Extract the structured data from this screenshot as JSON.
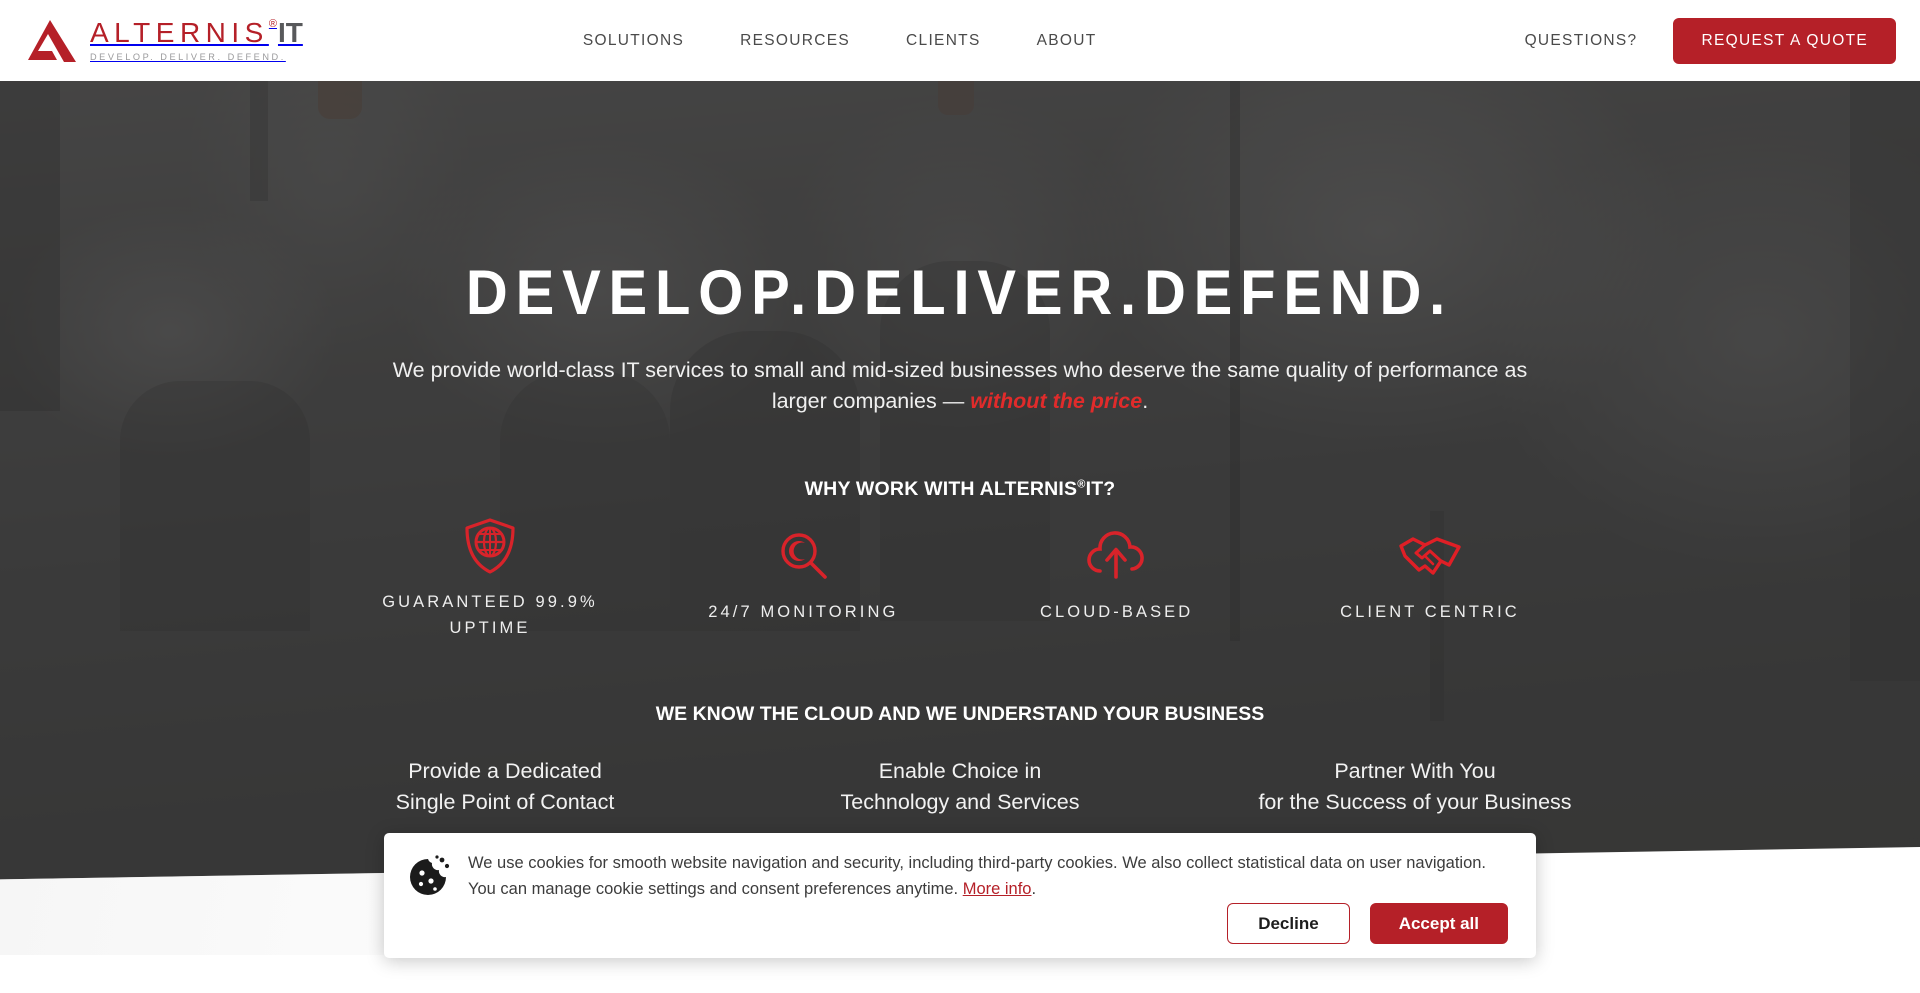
{
  "header": {
    "logo": {
      "name_main": "ALTERNIS",
      "registered_mark": "®",
      "name_suffix": "IT",
      "tagline": "DEVELOP. DELIVER. DEFEND."
    },
    "nav_items": [
      {
        "label": "SOLUTIONS"
      },
      {
        "label": "RESOURCES"
      },
      {
        "label": "CLIENTS"
      },
      {
        "label": "ABOUT"
      }
    ],
    "questions_label": "QUESTIONS?",
    "quote_button_label": "REQUEST A QUOTE"
  },
  "hero": {
    "title": "DEVELOP.DELIVER.DEFEND.",
    "subtitle_line1": "We provide world-class IT services to small and mid-sized businesses who deserve the same quality of performance",
    "subtitle_line2_prefix": "as larger companies — ",
    "subtitle_emphasis": "without the price",
    "subtitle_line2_suffix": ".",
    "why_title_prefix": "WHY WORK WITH ALTERNIS",
    "why_title_mark": "®",
    "why_title_suffix": "IT?"
  },
  "features": [
    {
      "icon": "shield-globe-icon",
      "label": "GUARANTEED 99.9% UPTIME"
    },
    {
      "icon": "magnifier-eye-icon",
      "label": "24/7 MONITORING"
    },
    {
      "icon": "cloud-upload-icon",
      "label": "CLOUD-BASED"
    },
    {
      "icon": "handshake-icon",
      "label": "CLIENT CENTRIC"
    }
  ],
  "cloud_section": {
    "title": "WE KNOW THE CLOUD AND WE UNDERSTAND YOUR BUSINESS",
    "columns": [
      {
        "line1": "Provide a Dedicated",
        "line2": "Single Point of Contact"
      },
      {
        "line1": "Enable Choice in",
        "line2": "Technology and Services"
      },
      {
        "line1": "Partner With You",
        "line2": "for the Success of your Business"
      }
    ]
  },
  "cookie_banner": {
    "icon": "cookie-icon",
    "text_part1": "We use cookies for smooth website navigation and security, including third-party cookies. We also collect statistical data on user navigation. You can manage cookie settings and consent preferences anytime. ",
    "more_info_label": "More info",
    "text_part2": ".",
    "decline_label": "Decline",
    "accept_label": "Accept all"
  },
  "colors": {
    "brand_red": "#b52028",
    "accent_red": "#e02b2b",
    "nav_text": "#4a4a4a",
    "logo_gray": "#58595b",
    "hero_overlay": "#343434"
  }
}
